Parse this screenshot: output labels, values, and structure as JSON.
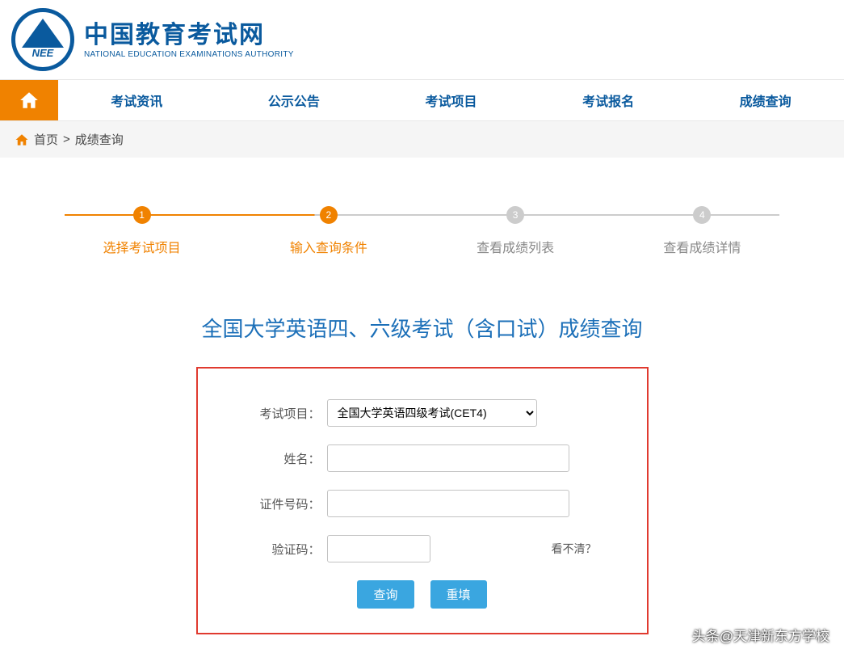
{
  "header": {
    "logo_text": "NEE",
    "title_cn": "中国教育考试网",
    "title_en": "NATIONAL EDUCATION EXAMINATIONS AUTHORITY"
  },
  "nav": {
    "items": [
      "考试资讯",
      "公示公告",
      "考试项目",
      "考试报名",
      "成绩查询"
    ]
  },
  "breadcrumb": {
    "home": "首页",
    "sep": ">",
    "current": "成绩查询"
  },
  "steps": [
    {
      "num": "1",
      "label": "选择考试项目",
      "active": true
    },
    {
      "num": "2",
      "label": "输入查询条件",
      "active": true
    },
    {
      "num": "3",
      "label": "查看成绩列表",
      "active": false
    },
    {
      "num": "4",
      "label": "查看成绩详情",
      "active": false
    }
  ],
  "panel": {
    "title": "全国大学英语四、六级考试（含口试）成绩查询",
    "fields": {
      "project_label": "考试项目：",
      "project_value": "全国大学英语四级考试(CET4)",
      "name_label": "姓名：",
      "name_value": "",
      "id_label": "证件号码：",
      "id_value": "",
      "captcha_label": "验证码：",
      "captcha_value": "",
      "captcha_hint": "看不清？"
    },
    "buttons": {
      "query": "查询",
      "reset": "重填"
    }
  },
  "watermark": "头条@天津新东方学校"
}
